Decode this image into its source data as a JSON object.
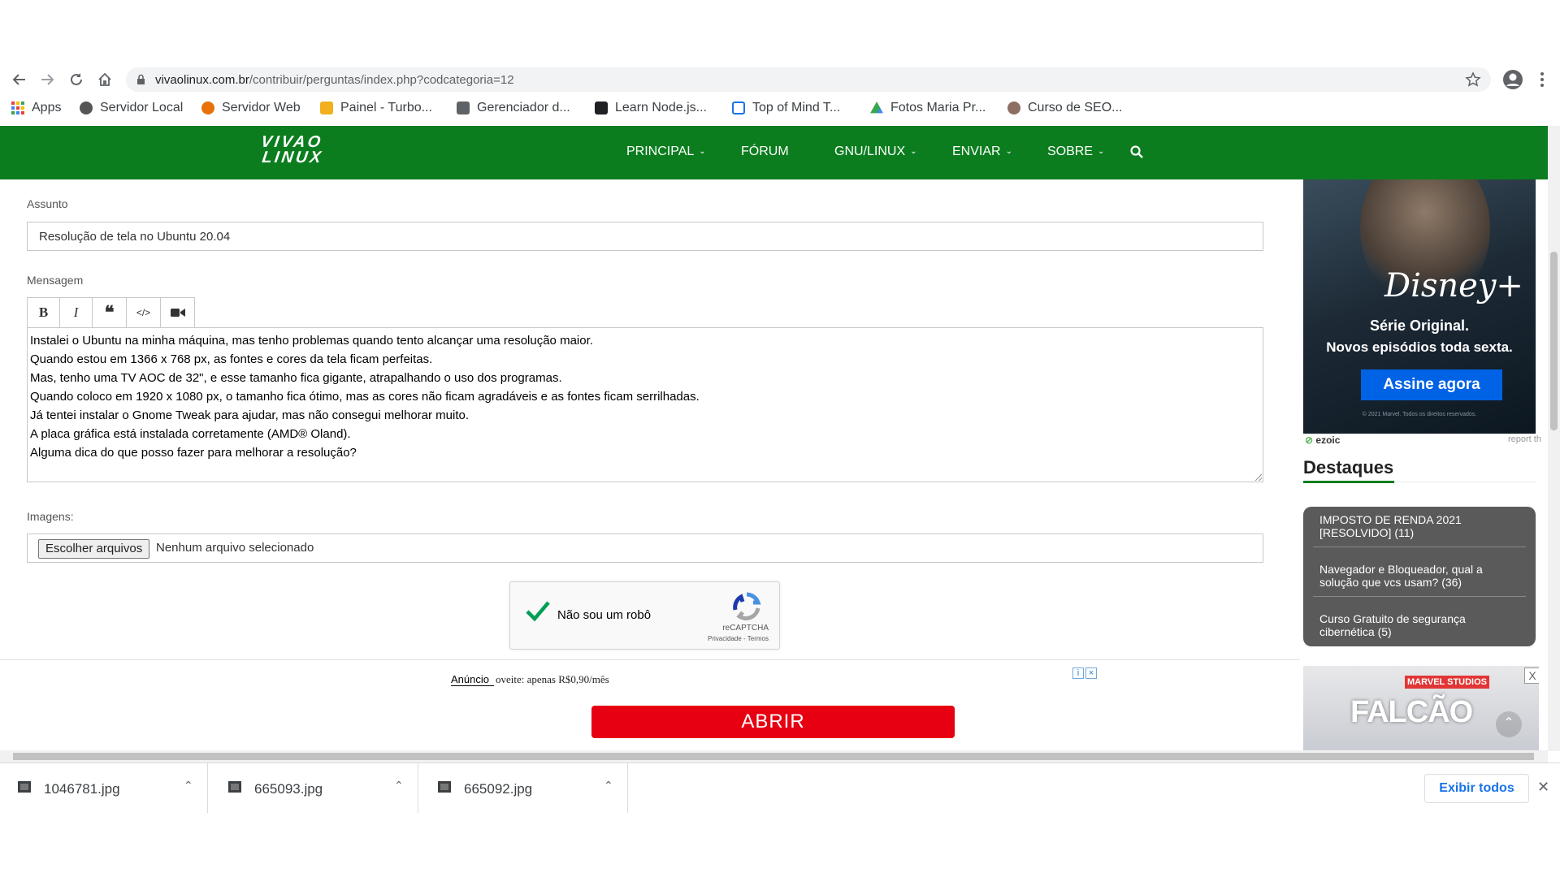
{
  "browser": {
    "url_host": "vivaolinux.com.br",
    "url_path": "/contribuir/perguntas/index.php?codcategoria=12",
    "bookmarks": [
      {
        "label": "Apps",
        "color": "#ea4335"
      },
      {
        "label": "Servidor Local",
        "color": "#555555"
      },
      {
        "label": "Servidor Web",
        "color": "#e8710a"
      },
      {
        "label": "Painel - Turbo...",
        "color": "#f2b01e"
      },
      {
        "label": "Gerenciador d...",
        "color": "#5f6368"
      },
      {
        "label": "Learn Node.js...",
        "color": "#202124"
      },
      {
        "label": "Top of Mind T...",
        "color": "#1a73e8"
      },
      {
        "label": "Fotos Maria Pr...",
        "color": "#34a853"
      },
      {
        "label": "Curso de SEO...",
        "color": "#8d6e63"
      }
    ]
  },
  "site": {
    "logo_line1": "VIVAO",
    "logo_line2": "LINUX",
    "brand_color": "#0b7d1e",
    "menu": [
      {
        "label": "PRINCIPAL",
        "has_dropdown": true
      },
      {
        "label": "FÓRUM",
        "has_dropdown": false
      },
      {
        "label": "GNU/LINUX",
        "has_dropdown": true
      },
      {
        "label": "ENVIAR",
        "has_dropdown": true
      },
      {
        "label": "SOBRE",
        "has_dropdown": true
      }
    ]
  },
  "form": {
    "subject_label": "Assunto",
    "subject_value": "Resolução de tela no Ubuntu 20.04",
    "message_label": "Mensagem",
    "toolbar": {
      "bold": "B",
      "italic": "I",
      "quote": "❝",
      "code": "</>",
      "video": "video-icon"
    },
    "message_lines": [
      "Instalei o Ubuntu na minha máquina, mas tenho problemas quando tento alcançar uma resolução maior.",
      "Quando estou em 1366 x 768 px, as fontes e cores da tela ficam perfeitas.",
      "Mas, tenho uma TV AOC de 32\", e esse tamanho fica gigante, atrapalhando o uso dos programas.",
      "Quando coloco em 1920 x 1080 px, o tamanho fica ótimo, mas as cores não ficam agradáveis e as fontes ficam serrilhadas.",
      "Já tentei instalar o Gnome Tweak para ajudar, mas não consegui melhorar muito.",
      "A placa gráfica está instalada corretamente (AMD® Oland).",
      "Alguma dica do que posso fazer para melhorar a resolução?"
    ],
    "images_label": "Imagens:",
    "file_button": "Escolher arquivos",
    "file_status": "Nenhum arquivo selecionado",
    "captcha": {
      "label": "Não sou um robô",
      "checked": true,
      "brand": "reCAPTCHA",
      "links": "Privacidade - Termos"
    }
  },
  "ad_banner": {
    "label": "Anúncio",
    "text": "oveite: apenas R$0,90/mês",
    "cta": "ABRIR",
    "cta_color": "#e60012"
  },
  "sidebar": {
    "ad_disney": {
      "brand": "Disney+",
      "line1": "Série Original.",
      "line2": "Novos episódios toda sexta.",
      "button": "Assine agora",
      "fine_print": "© 2021 Marvel. Todos os direitos reservados."
    },
    "ezoic": "ezoic",
    "report": "report th",
    "destaques_title": "Destaques",
    "destaques": [
      "IMPOSTO DE RENDA 2021 [RESOLVIDO] (11)",
      "Navegador e Bloqueador, qual a solução que vcs usam? (36)",
      "Curso Gratuito de segurança cibernética (5)"
    ],
    "ad_falcao": {
      "studio": "MARVEL STUDIOS",
      "title": "FALCÃO",
      "close": "X"
    }
  },
  "downloads": {
    "files": [
      "1046781.jpg",
      "665093.jpg",
      "665092.jpg"
    ],
    "show_all": "Exibir todos"
  }
}
